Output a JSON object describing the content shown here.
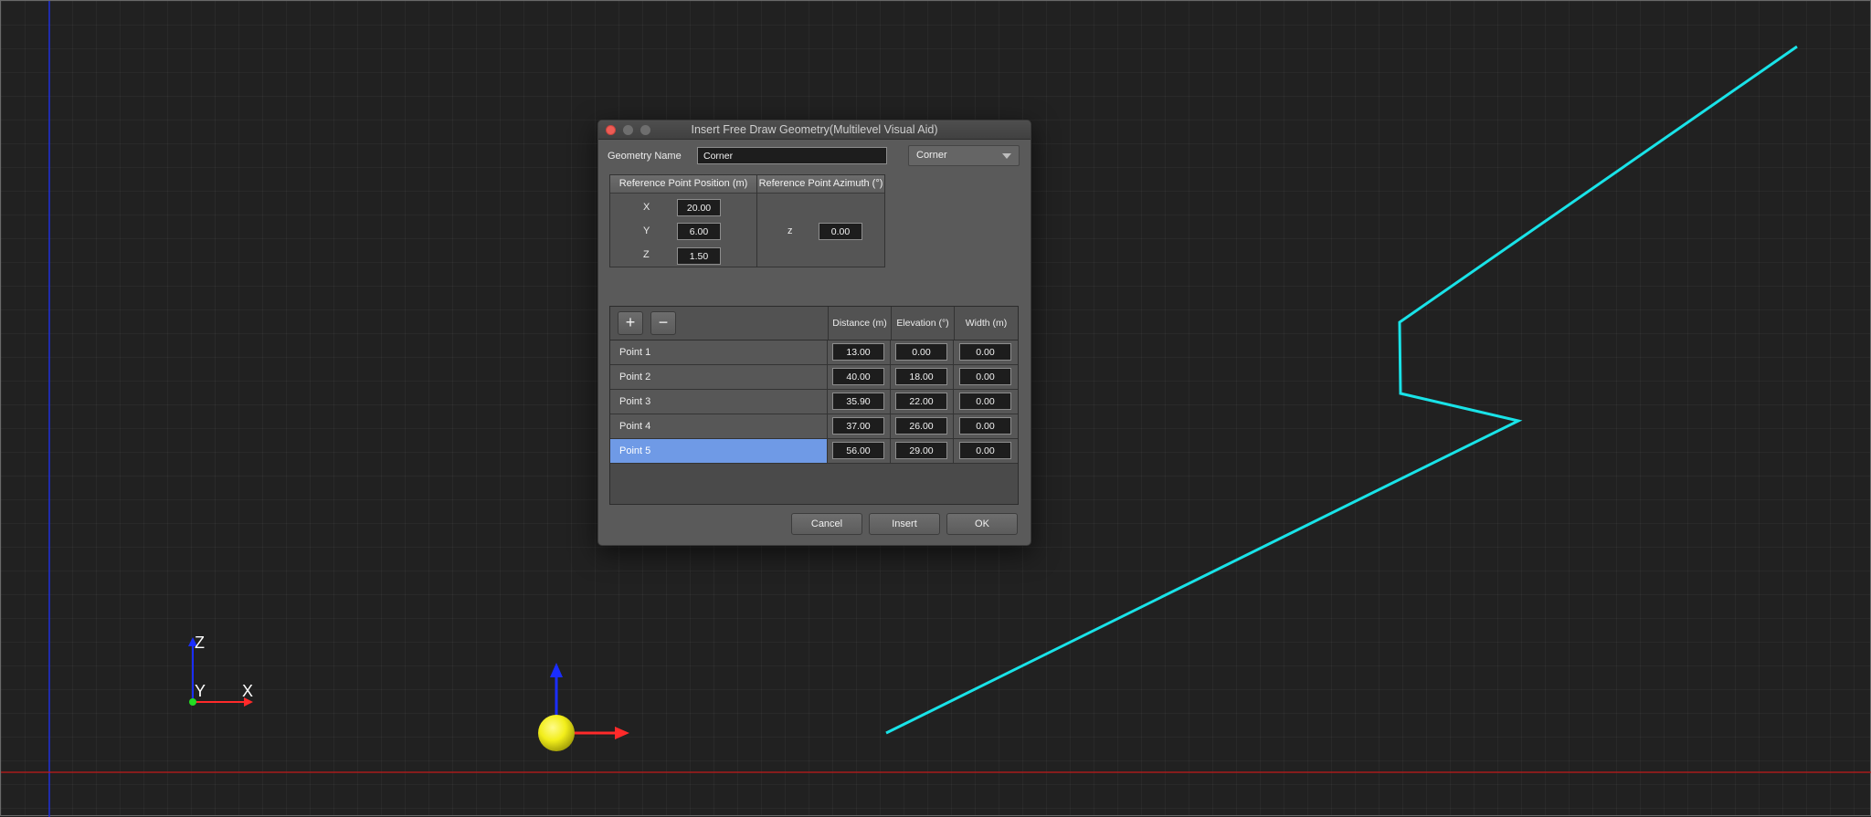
{
  "window": {
    "title": "Insert Free Draw Geometry(Multilevel Visual Aid)"
  },
  "geometry": {
    "name_label": "Geometry Name",
    "name_value": "Corner",
    "type_selected": "Corner"
  },
  "reference": {
    "position_header": "Reference Point Position (m)",
    "azimuth_header": "Reference Point Azimuth (°)",
    "x_label": "X",
    "x_value": "20.00",
    "y_label": "Y",
    "y_value": "6.00",
    "z_label": "Z",
    "z_value": "1.50",
    "az_label": "z",
    "az_value": "0.00"
  },
  "points_table": {
    "add_label": "+",
    "remove_label": "−",
    "columns": [
      "Distance (m)",
      "Elevation (°)",
      "Width (m)"
    ],
    "rows": [
      {
        "name": "Point 1",
        "distance": "13.00",
        "elevation": "0.00",
        "width": "0.00"
      },
      {
        "name": "Point 2",
        "distance": "40.00",
        "elevation": "18.00",
        "width": "0.00"
      },
      {
        "name": "Point 3",
        "distance": "35.90",
        "elevation": "22.00",
        "width": "0.00"
      },
      {
        "name": "Point 4",
        "distance": "37.00",
        "elevation": "26.00",
        "width": "0.00"
      },
      {
        "name": "Point 5",
        "distance": "56.00",
        "elevation": "29.00",
        "width": "0.00"
      }
    ],
    "selected_row": "Point 5"
  },
  "buttons": {
    "cancel": "Cancel",
    "insert": "Insert",
    "ok": "OK"
  },
  "axes": {
    "z": "Z",
    "y": "Y",
    "x": "X"
  },
  "colors": {
    "geometry_line": "#19e3e8",
    "selection": "#6f9ae6",
    "x_axis": "#ff2a2a",
    "y_axis": "#22dd22",
    "z_axis": "#1a2dff",
    "marker": "#f2ee1a"
  }
}
